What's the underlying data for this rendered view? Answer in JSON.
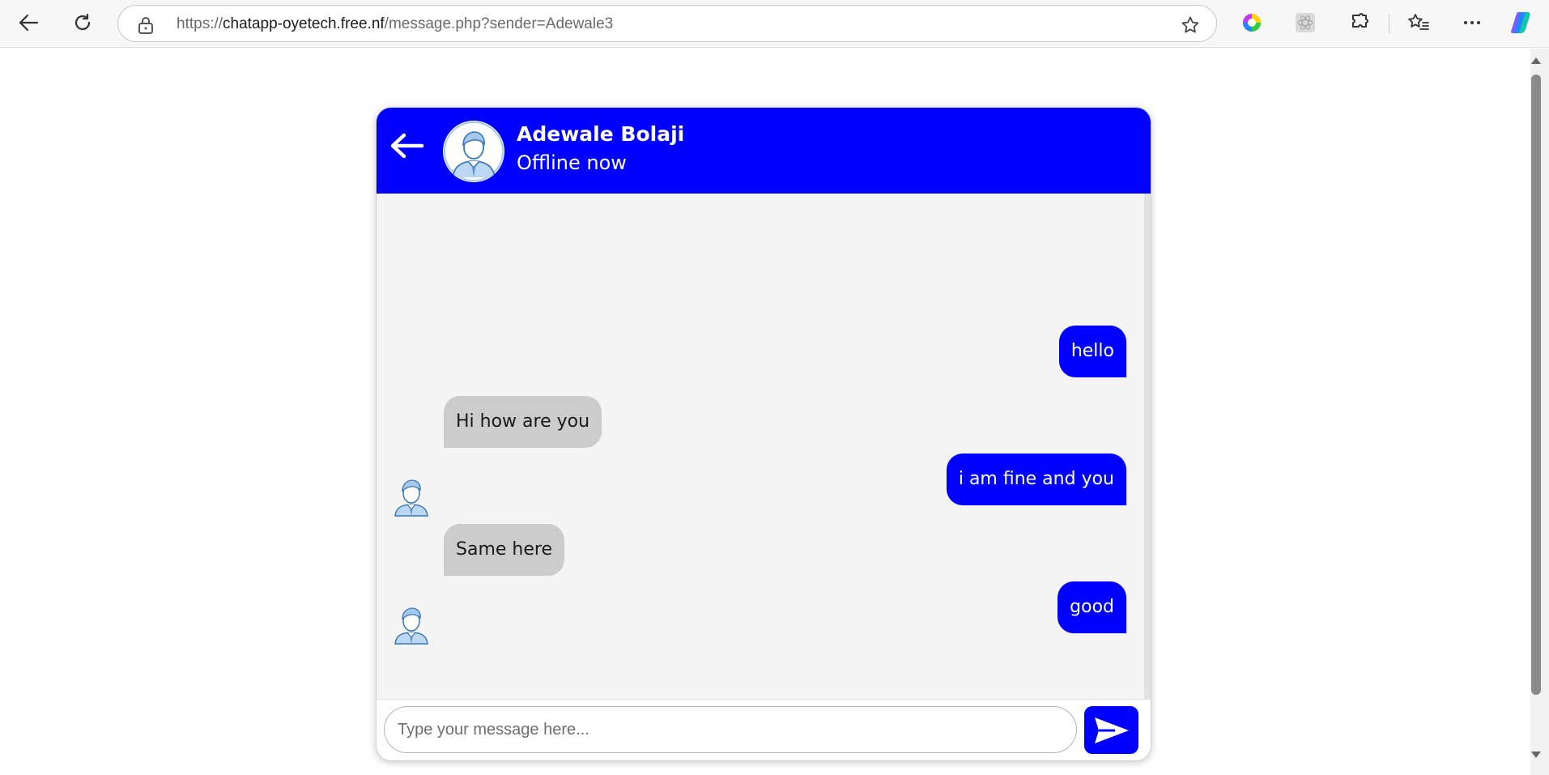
{
  "browser": {
    "url_prefix": "https://",
    "url_host": "chatapp-oyetech.free.nf",
    "url_path": "/message.php?sender=Adewale3"
  },
  "chat": {
    "header": {
      "name": "Adewale Bolaji",
      "status": "Offline now"
    },
    "messages": [
      {
        "direction": "outgoing",
        "text": "hello"
      },
      {
        "direction": "incoming",
        "text": "Hi how are you"
      },
      {
        "direction": "outgoing",
        "text": "i am fine and you"
      },
      {
        "direction": "incoming",
        "text": "Same here"
      },
      {
        "direction": "outgoing",
        "text": "good"
      }
    ],
    "input": {
      "placeholder": "Type your message here...",
      "value": ""
    }
  },
  "colors": {
    "accent": "#0000ff",
    "incoming_bubble": "#cccccc",
    "chat_background": "#f4f4f4"
  }
}
